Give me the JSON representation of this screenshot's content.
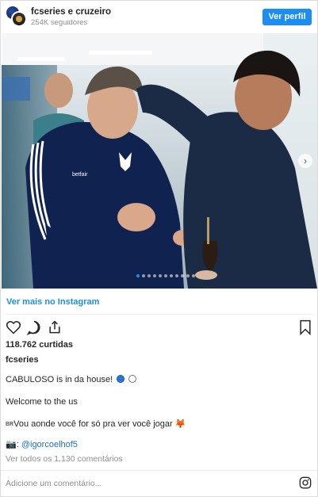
{
  "header": {
    "username": "fcseries e cruzeiro",
    "followers": "254K seguidores",
    "profile_button": "Ver perfil"
  },
  "photo": {
    "shirt_logo_text": "betfair",
    "carousel_dots": 11,
    "active_dot": 0,
    "next_icon": "chevron-right-icon"
  },
  "view_more": "Ver mais no Instagram",
  "actions": {
    "like_icon": "heart-icon",
    "comment_icon": "comment-icon",
    "share_icon": "share-icon",
    "save_icon": "bookmark-icon"
  },
  "likes": "118.762 curtidas",
  "post_user": "fcseries",
  "caption": {
    "line1": "CABULOSO is in da house!",
    "line2": "Welcome to the us",
    "line3_prefix": "BR",
    "line3": "Vou aonde você for só pra ver você jogar",
    "line3_emoji": "🦊",
    "line4_emoji": "📷",
    "line4_prefix": ": ",
    "line4_mention": "@igorcoelhof5"
  },
  "view_comments": "Ver todos os 1.130 comentários",
  "comment_placeholder": "Adicione um comentário...",
  "colors": {
    "accent": "#1c8df3",
    "kit_navy": "#10224f"
  }
}
